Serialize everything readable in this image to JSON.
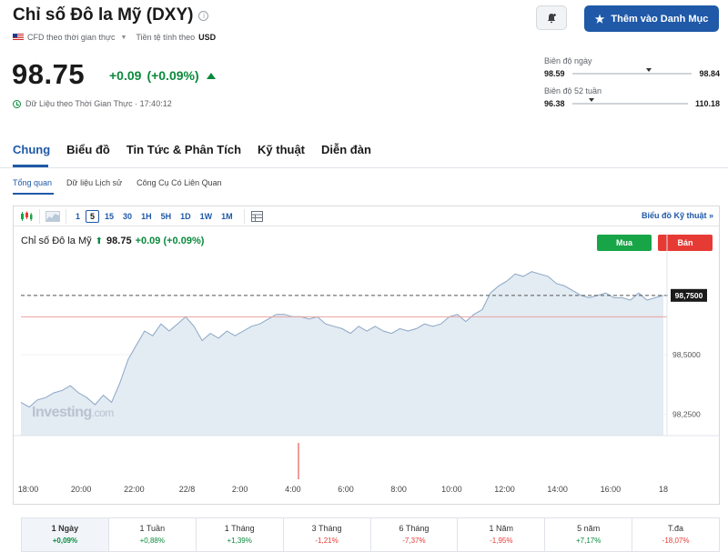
{
  "header": {
    "title": "Chỉ số Đô la Mỹ (DXY)",
    "cfd_label": "CFD theo thời gian thực",
    "currency_label": "Tiền tệ tính theo",
    "currency_value": "USD",
    "watchlist_button": "Thêm vào Danh Mục"
  },
  "quote": {
    "price": "98.75",
    "change": "+0.09",
    "change_pct": "(+0.09%)",
    "realtime": "Dữ Liệu theo Thời Gian Thực · 17:40:12"
  },
  "ranges": {
    "day": {
      "label": "Biên độ ngày",
      "low": "98.59",
      "high": "98.84",
      "position": 0.64
    },
    "week52": {
      "label": "Biên độ 52 tuần",
      "low": "96.38",
      "high": "110.18",
      "position": 0.17
    }
  },
  "tabs": [
    "Chung",
    "Biểu đồ",
    "Tin Tức & Phân Tích",
    "Kỹ thuật",
    "Diễn đàn"
  ],
  "subtabs": [
    "Tổng quan",
    "Dữ liệu Lịch sử",
    "Công Cụ Có Liên Quan"
  ],
  "toolbar": {
    "periods": [
      "1",
      "5",
      "15",
      "30",
      "1H",
      "5H",
      "1D",
      "1W",
      "1M"
    ],
    "active_period": "5",
    "technical_link": "Biểu đồ Kỹ thuật »"
  },
  "chart_legend": {
    "name": "Chỉ số Đô la Mỹ",
    "price": "98.75",
    "change": "+0.09 (+0.09%)",
    "buy": "Mua",
    "sell": "Bán"
  },
  "watermark": {
    "brand": "Investing",
    "suffix": ".com"
  },
  "chart_data": {
    "type": "area",
    "title": "",
    "xlabel": "",
    "ylabel": "",
    "x_ticks": [
      "18:00",
      "20:00",
      "22:00",
      "22/8",
      "2:00",
      "4:00",
      "6:00",
      "8:00",
      "10:00",
      "12:00",
      "14:00",
      "16:00",
      "18"
    ],
    "y_ticks": [
      "98,7500",
      "98,5000",
      "98,2500"
    ],
    "ylim": [
      98.16,
      98.91
    ],
    "current_value_label": "98,7500",
    "current_value": 98.75,
    "reference_line": 98.66,
    "series": [
      {
        "values": [
          98.3,
          98.28,
          98.31,
          98.32,
          98.34,
          98.35,
          98.37,
          98.34,
          98.32,
          98.29,
          98.33,
          98.3,
          98.38,
          98.48,
          98.54,
          98.6,
          98.58,
          98.63,
          98.6,
          98.63,
          98.66,
          98.62,
          98.56,
          98.59,
          98.57,
          98.6,
          98.58,
          98.6,
          98.62,
          98.63,
          98.65,
          98.67,
          98.67,
          98.66,
          98.66,
          98.65,
          98.66,
          98.63,
          98.62,
          98.61,
          98.59,
          98.62,
          98.6,
          98.62,
          98.6,
          98.59,
          98.61,
          98.6,
          98.61,
          98.63,
          98.62,
          98.63,
          98.66,
          98.67,
          98.64,
          98.67,
          98.69,
          98.76,
          98.79,
          98.81,
          98.84,
          98.83,
          98.85,
          98.84,
          98.83,
          98.8,
          98.79,
          98.77,
          98.75,
          98.74,
          98.75,
          98.76,
          98.74,
          98.74,
          98.73,
          98.76,
          98.73,
          98.74,
          98.75
        ]
      }
    ]
  },
  "performance": [
    {
      "period": "1 Ngày",
      "value": "+0,09%",
      "sign": "pos"
    },
    {
      "period": "1 Tuần",
      "value": "+0,88%",
      "sign": "pos"
    },
    {
      "period": "1 Tháng",
      "value": "+1,39%",
      "sign": "pos"
    },
    {
      "period": "3 Tháng",
      "value": "-1,21%",
      "sign": "neg"
    },
    {
      "period": "6 Tháng",
      "value": "-7,37%",
      "sign": "neg"
    },
    {
      "period": "1 Năm",
      "value": "-1,95%",
      "sign": "neg"
    },
    {
      "period": "5 năm",
      "value": "+7,17%",
      "sign": "pos"
    },
    {
      "period": "T.đa",
      "value": "-18,07%",
      "sign": "neg"
    }
  ],
  "colors": {
    "accent": "#1f59a8",
    "positive": "#0a8a3c",
    "negative": "#e63b35",
    "area_fill": "#e3ebf3",
    "area_line": "#8aa6c4"
  }
}
